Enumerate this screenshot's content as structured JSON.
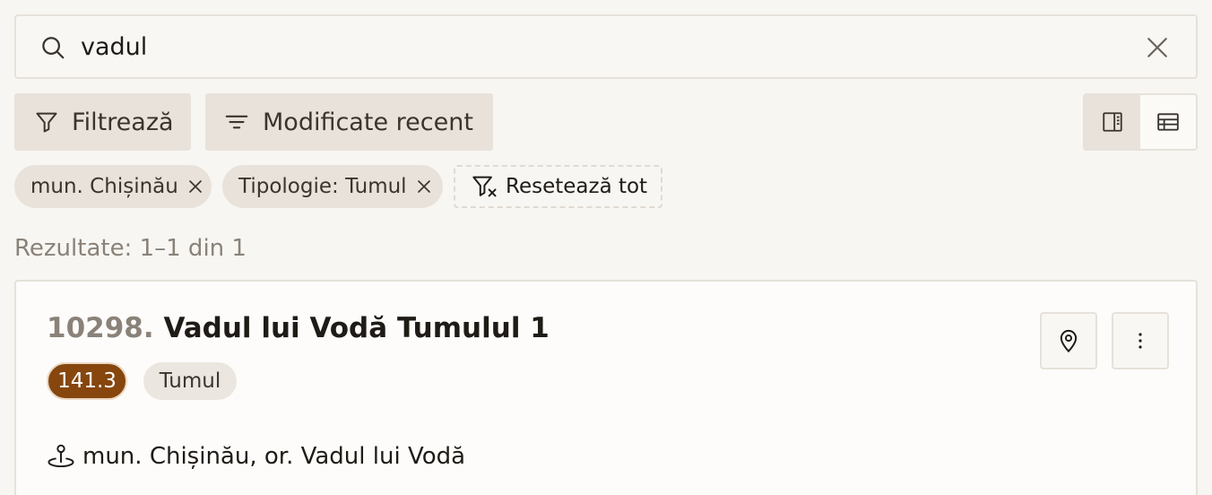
{
  "search": {
    "value": "vadul"
  },
  "toolbar": {
    "filter_label": "Filtrează",
    "sort_label": "Modificate recent"
  },
  "active_filters": [
    {
      "label": "mun. Chișinău"
    },
    {
      "label": "Tipologie: Tumul"
    }
  ],
  "reset_label": "Resetează tot",
  "results_text": "Rezultate: 1–1 din 1",
  "results": [
    {
      "number": "10298.",
      "title": "Vadul lui Vodă Tumulul 1",
      "code_badge": "141.3",
      "type_badge": "Tumul",
      "location": "mun. Chișinău, or. Vadul lui Vodă"
    }
  ],
  "colors": {
    "accent_brown": "#86460d",
    "chip_bg": "#e8e2da",
    "page_bg": "#f8f6f2"
  }
}
